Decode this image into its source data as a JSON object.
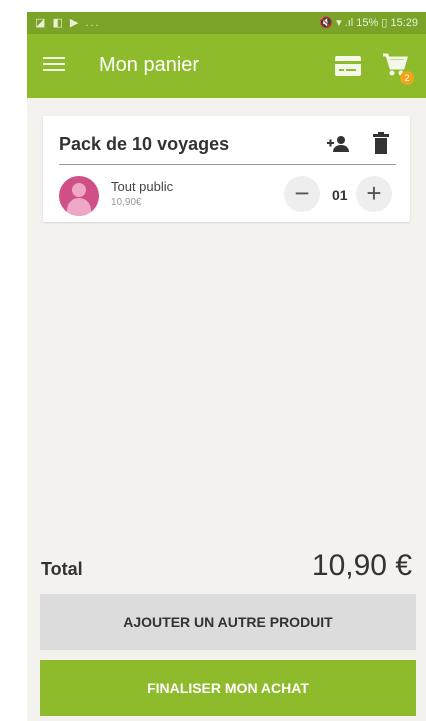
{
  "status_bar": {
    "left_icons": "◪ ◧ ▶ ...",
    "right_text": "🔇 ▾ .ıl 15% ▯ 15:29"
  },
  "app_bar": {
    "title": "Mon panier",
    "cart_badge": "2"
  },
  "product": {
    "title": "Pack de 10 voyages",
    "line": {
      "name": "Tout public",
      "price": "10,90€",
      "quantity": "01"
    }
  },
  "total": {
    "label": "Total",
    "value": "10,90 €"
  },
  "buttons": {
    "add_product": "AJOUTER UN AUTRE PRODUIT",
    "finalize": "FINALISER MON ACHAT"
  },
  "colors": {
    "app_bar": "#8dbb2c",
    "status_bar": "#7aa328",
    "badge": "#f2a51a",
    "avatar": "#d04f87"
  },
  "icons": [
    "menu-icon",
    "card-icon",
    "cart-icon",
    "add-person-icon",
    "trash-icon",
    "person-avatar-icon",
    "minus-icon",
    "plus-icon"
  ]
}
